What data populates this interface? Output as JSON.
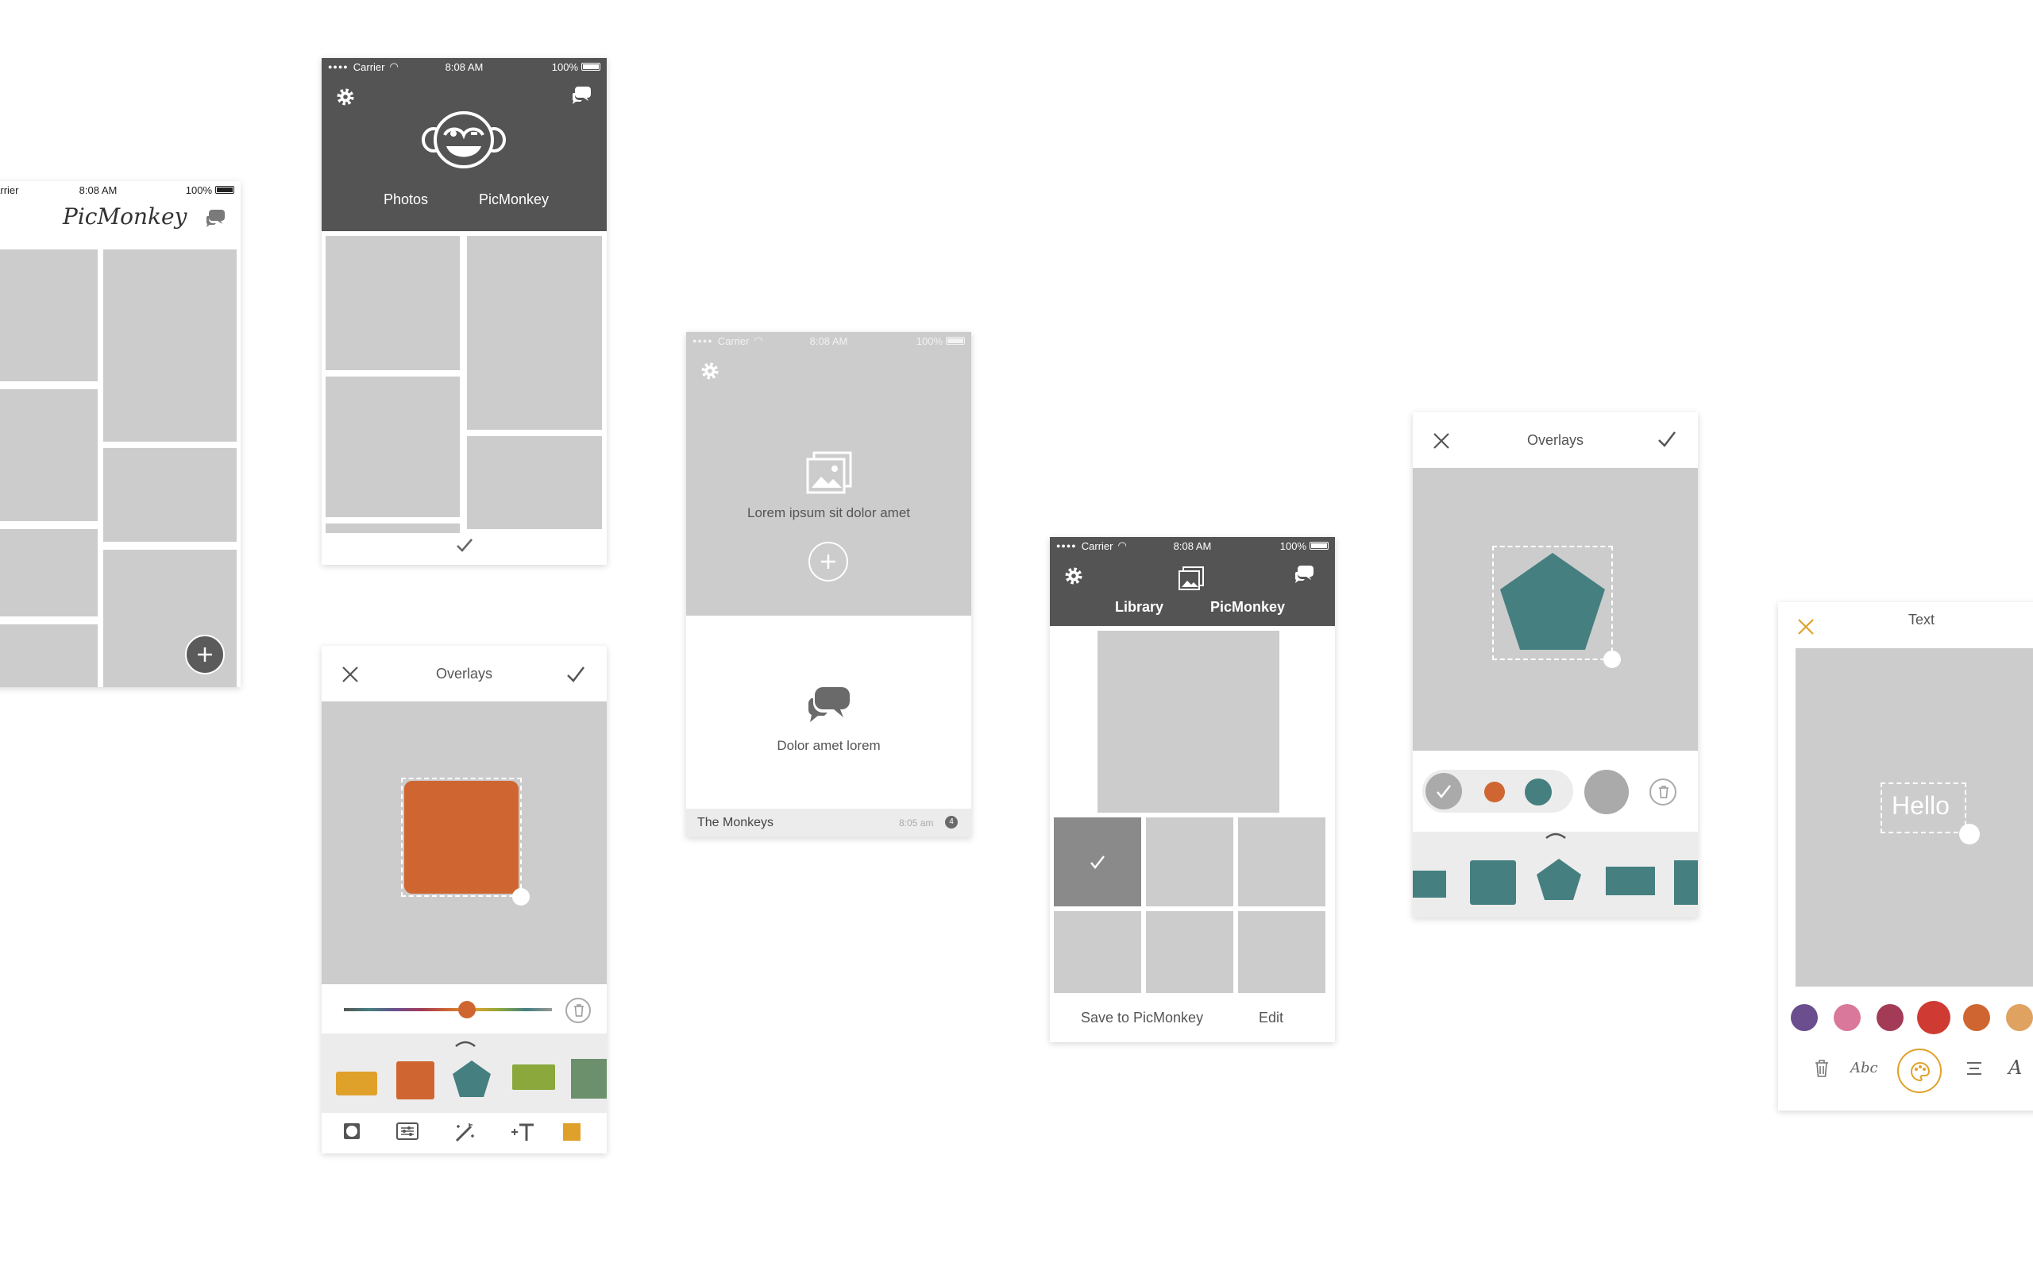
{
  "status": {
    "carrier": "Carrier",
    "time": "8:08 AM",
    "battery": "100%"
  },
  "screen1": {
    "logo": "PicMonkey"
  },
  "screen2": {
    "tabs": [
      "Photos",
      "PicMonkey"
    ]
  },
  "screen3": {
    "upload_text": "Lorem ipsum sit dolor amet",
    "chat_text": "Dolor amet lorem",
    "footer_title": "The Monkeys",
    "footer_time": "8:05 am",
    "footer_count": "4"
  },
  "screen4": {
    "title": "Overlays"
  },
  "screen5": {
    "tabs": [
      "Library",
      "PicMonkey"
    ],
    "save_label": "Save to PicMonkey",
    "edit_label": "Edit"
  },
  "screen6": {
    "title": "Overlays"
  },
  "screen7": {
    "title": "Text",
    "sample_text": "Hello"
  },
  "colors": {
    "accent_orange": "#cf6631",
    "teal": "#457f80",
    "dark_header": "#545454",
    "gold": "#e0a12b",
    "placeholder": "#cccccc"
  }
}
